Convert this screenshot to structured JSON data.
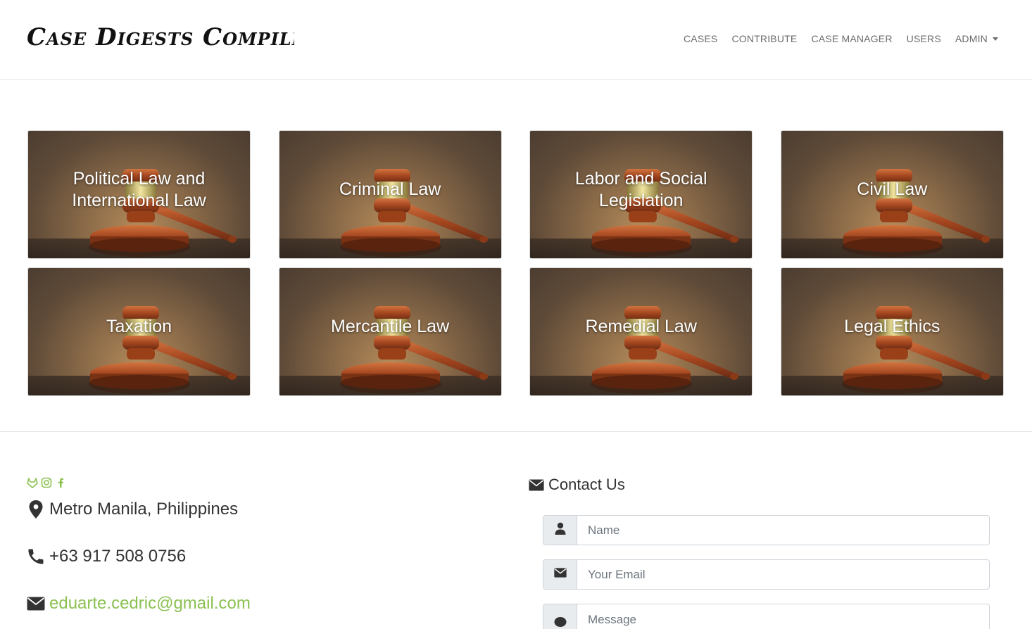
{
  "brand": {
    "title": "Case Digests Compiler"
  },
  "nav": {
    "items": [
      {
        "label": "CASES"
      },
      {
        "label": "CONTRIBUTE"
      },
      {
        "label": "CASE MANAGER"
      },
      {
        "label": "USERS"
      },
      {
        "label": "ADMIN"
      }
    ]
  },
  "categories": [
    {
      "label": "Political Law and International Law"
    },
    {
      "label": "Criminal Law"
    },
    {
      "label": "Labor and Social Legislation"
    },
    {
      "label": "Civil Law"
    },
    {
      "label": "Taxation"
    },
    {
      "label": "Mercantile Law"
    },
    {
      "label": "Remedial Law"
    },
    {
      "label": "Legal Ethics"
    }
  ],
  "footer": {
    "social_icons": [
      "gitlab-icon",
      "instagram-icon",
      "facebook-icon"
    ],
    "location": "Metro Manila, Philippines",
    "phone": "+63 917 508 0756",
    "email": "eduarte.cedric@gmail.com",
    "contact_title": "Contact Us",
    "form": {
      "name_placeholder": "Name",
      "email_placeholder": "Your Email",
      "message_placeholder": "Message"
    }
  },
  "colors": {
    "accent": "#8cc152",
    "nav_text": "#6b6b6b",
    "text": "#333333"
  }
}
